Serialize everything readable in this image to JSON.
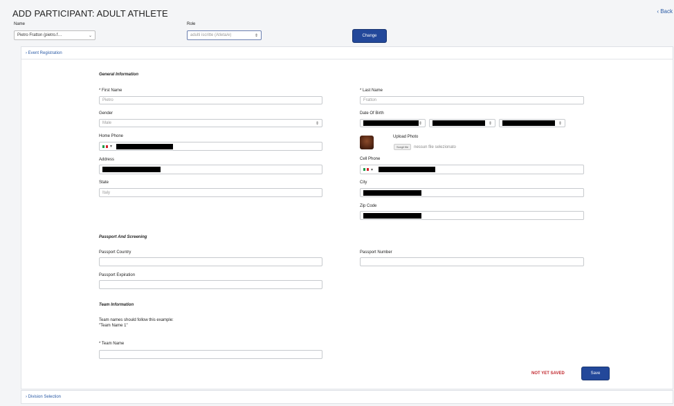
{
  "header": {
    "title": "ADD PARTICIPANT: ADULT ATHLETE",
    "back_label": "‹ Back"
  },
  "selector": {
    "name_label": "Name",
    "name_value": "Pietro Fratton (pietro.f…",
    "role_label": "Role",
    "role_value": "adulti iscritte (Atleta/e)",
    "change_button": "Change"
  },
  "accordion": {
    "event_registration": "› Event Registration",
    "division_selection": "› Division Selection"
  },
  "general": {
    "heading": "General Information",
    "first_name_label": "* First Name",
    "first_name_value": "Pietro",
    "last_name_label": "* Last Name",
    "last_name_value": "Fratton",
    "gender_label": "Gender",
    "gender_value": "Male",
    "dob_label": "Date Of Birth",
    "home_phone_label": "Home Phone",
    "upload_photo_label": "Upload Photo",
    "choose_file": "Scegli file",
    "no_file": "nessun file selezionato",
    "address_label": "Address",
    "cell_phone_label": "Cell Phone",
    "state_label": "State",
    "state_value": "Italy",
    "city_label": "City",
    "zip_label": "Zip Code"
  },
  "passport": {
    "heading": "Passport And Screening",
    "country_label": "Passport Country",
    "number_label": "Passport Number",
    "expiration_label": "Passport Expiration"
  },
  "team": {
    "heading": "Team Information",
    "hint_line1": "Team names should follow this example:",
    "hint_line2": "\"Team Name 1\"",
    "team_name_label": "* Team Name"
  },
  "footer": {
    "status": "NOT YET SAVED",
    "save_button": "Save"
  },
  "colors": {
    "accent": "#23489a",
    "link": "#2a5aa5",
    "warning": "#c1272d"
  }
}
